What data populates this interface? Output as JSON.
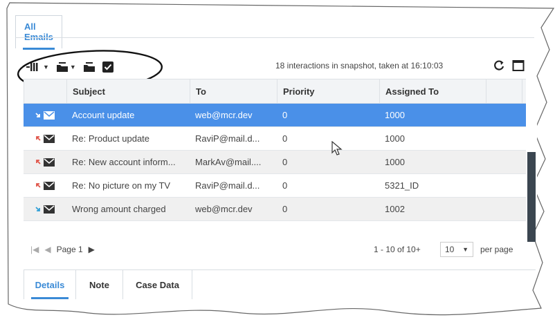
{
  "tabs": {
    "active": "All Emails"
  },
  "toolbar": {
    "icons": [
      "column-chooser-icon",
      "move-to-folder-icon",
      "folder-icon",
      "checkbox-icon"
    ],
    "snapshot_text": "18 interactions in snapshot, taken at 16:10:03",
    "refresh_icon": "refresh-icon",
    "maximize_icon": "maximize-icon"
  },
  "table": {
    "headers": [
      "Subject",
      "To",
      "Priority",
      "Assigned To"
    ],
    "rows": [
      {
        "status": "inbound",
        "subject": "Account update",
        "to": "web@mcr.dev",
        "priority": "0",
        "assigned": "1000",
        "selected": true
      },
      {
        "status": "outbound",
        "subject": "Re: Product update",
        "to": "RaviP@mail.d...",
        "priority": "0",
        "assigned": "1000"
      },
      {
        "status": "outbound",
        "subject": "Re: New account inform...",
        "to": "MarkAv@mail....",
        "priority": "0",
        "assigned": "1000"
      },
      {
        "status": "outbound",
        "subject": "Re: No picture on my TV",
        "to": "RaviP@mail.d...",
        "priority": "0",
        "assigned": "5321_ID"
      },
      {
        "status": "inbound",
        "subject": "Wrong amount charged",
        "to": "web@mcr.dev",
        "priority": "0",
        "assigned": "1002"
      }
    ]
  },
  "pager": {
    "page_label": "Page 1",
    "count_text": "1 - 10 of 10+",
    "page_size": "10",
    "per_page_label": "per page"
  },
  "bottom_tabs": [
    "Details",
    "Note",
    "Case Data"
  ],
  "colors": {
    "accent": "#3a8ad6",
    "selected_row": "#4a90e8",
    "inbound_arrow": "#2f9fd6",
    "outbound_arrow": "#e0554a"
  }
}
